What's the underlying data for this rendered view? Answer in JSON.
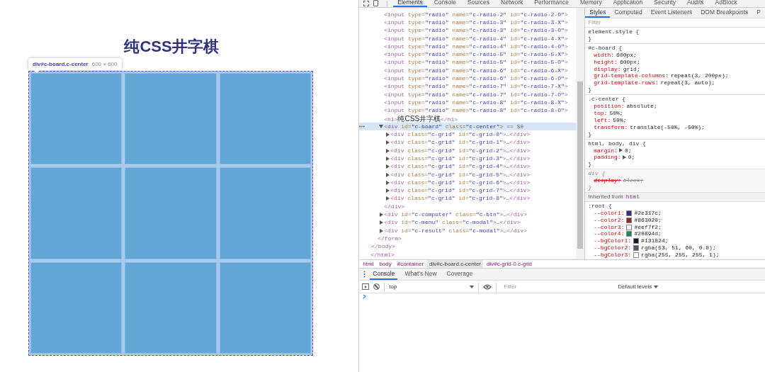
{
  "page": {
    "title": "纯CSS井字棋",
    "tooltip": {
      "selector": "div#c-board.c-center",
      "size": "600 × 600"
    }
  },
  "devtools": {
    "tabs": [
      {
        "label": "Elements",
        "selected": true
      },
      {
        "label": "Console",
        "selected": false
      },
      {
        "label": "Sources",
        "selected": false
      },
      {
        "label": "Network",
        "selected": false
      },
      {
        "label": "Performance",
        "selected": false
      },
      {
        "label": "Memory",
        "selected": false
      },
      {
        "label": "Application",
        "selected": false
      },
      {
        "label": "Security",
        "selected": false
      },
      {
        "label": "Audits",
        "selected": false
      },
      {
        "label": "AdBlock",
        "selected": false
      }
    ],
    "dom": [
      {
        "children": [
          {
            "children": [
              {
                "children": [
                  {
                    "open": "<input type=\"radio\" name=\"c-radio-2\" id=\"c-radio-2-O\">"
                  },
                  {
                    "open": "<input type=\"radio\" name=\"c-radio-3\" id=\"c-radio-3-X\">"
                  },
                  {
                    "open": "<input type=\"radio\" name=\"c-radio-3\" id=\"c-radio-3-O\">"
                  },
                  {
                    "open": "<input type=\"radio\" name=\"c-radio-4\" id=\"c-radio-4-X\">"
                  },
                  {
                    "open": "<input type=\"radio\" name=\"c-radio-4\" id=\"c-radio-4-O\">"
                  },
                  {
                    "open": "<input type=\"radio\" name=\"c-radio-5\" id=\"c-radio-5-X\">"
                  },
                  {
                    "open": "<input type=\"radio\" name=\"c-radio-5\" id=\"c-radio-5-O\">"
                  },
                  {
                    "open": "<input type=\"radio\" name=\"c-radio-6\" id=\"c-radio-6-X\">"
                  },
                  {
                    "open": "<input type=\"radio\" name=\"c-radio-6\" id=\"c-radio-6-O\">"
                  },
                  {
                    "open": "<input type=\"radio\" name=\"c-radio-7\" id=\"c-radio-7-X\">"
                  },
                  {
                    "open": "<input type=\"radio\" name=\"c-radio-7\" id=\"c-radio-7-O\">"
                  },
                  {
                    "open": "<input type=\"radio\" name=\"c-radio-8\" id=\"c-radio-8-X\">"
                  },
                  {
                    "open": "<input type=\"radio\" name=\"c-radio-8\" id=\"c-radio-8-O\">"
                  },
                  {
                    "open": "<h1>纯CSS井字棋</h1>"
                  },
                  {
                    "open": "<div id=\"c-board\" class=\"c-center\">",
                    "suffix": "== $0",
                    "selected": true,
                    "expanded": true,
                    "close": "</div>",
                    "children": [
                      {
                        "open": "<div class=\"c-grid\" id=\"c-grid-0\">…</div>",
                        "expanded": false,
                        "selected": false
                      },
                      {
                        "open": "<div class=\"c-grid\" id=\"c-grid-1\">…</div>",
                        "expanded": false,
                        "selected": false
                      },
                      {
                        "open": "<div class=\"c-grid\" id=\"c-grid-2\">…</div>",
                        "expanded": false,
                        "selected": false
                      },
                      {
                        "open": "<div class=\"c-grid\" id=\"c-grid-3\">…</div>",
                        "expanded": false,
                        "selected": false
                      },
                      {
                        "open": "<div class=\"c-grid\" id=\"c-grid-4\">…</div>",
                        "expanded": false,
                        "selected": false
                      },
                      {
                        "open": "<div class=\"c-grid\" id=\"c-grid-5\">…</div>",
                        "expanded": false,
                        "selected": false
                      },
                      {
                        "open": "<div class=\"c-grid\" id=\"c-grid-6\">…</div>",
                        "expanded": false,
                        "selected": false
                      },
                      {
                        "open": "<div class=\"c-grid\" id=\"c-grid-7\">…</div>",
                        "expanded": false,
                        "selected": false
                      },
                      {
                        "open": "<div class=\"c-grid\" id=\"c-grid-8\">…</div>",
                        "expanded": false,
                        "selected": false
                      }
                    ]
                  },
                  {
                    "open": "<div id=\"c-computer\" class=\"c-btn\">…</div>",
                    "expanded": false,
                    "selected": false
                  },
                  {
                    "open": "<div id=\"c-menu\" class=\"c-modal\">…</div>",
                    "expanded": false,
                    "selected": false
                  },
                  {
                    "open": "<div id=\"c-result\" class=\"c-modal\">…</div>",
                    "expanded": false,
                    "selected": false
                  }
                ],
                "close": "</form>"
              }
            ],
            "close": "</body>"
          }
        ],
        "close": "</html>"
      }
    ],
    "breadcrumbs": [
      {
        "label": "html",
        "selected": false
      },
      {
        "label": "body",
        "selected": false
      },
      {
        "label": "#container",
        "selected": false
      },
      {
        "label": "div#c-board.c-center",
        "selected": true
      },
      {
        "label": "div#c-grid-0.c-grid",
        "selected": false
      }
    ],
    "styles": {
      "tabs": [
        {
          "label": "Styles",
          "selected": true
        },
        {
          "label": "Computed",
          "selected": false
        },
        {
          "label": "Event Listeners",
          "selected": false
        },
        {
          "label": "DOM Breakpoints",
          "selected": false
        },
        {
          "label": "P",
          "selected": false
        }
      ],
      "filter": {
        "placeholder": "Filter"
      },
      "rules": [
        {
          "kind": "author",
          "selector": "element.style {",
          "close": "}"
        },
        {
          "kind": "author",
          "selector": "#c-board {",
          "close": "}",
          "props": [
            {
              "name": "width:",
              "value": "600px;"
            },
            {
              "name": "height:",
              "value": "600px;"
            },
            {
              "name": "display:",
              "value": "grid;"
            },
            {
              "name": "grid-template-columns:",
              "value": "repeat(3, 200px);"
            },
            {
              "name": "grid-template-rows:",
              "value": "repeat(3, auto);"
            }
          ]
        },
        {
          "kind": "author",
          "selector": ".c-center {",
          "close": "}",
          "props": [
            {
              "name": "position:",
              "value": "absolute;"
            },
            {
              "name": "top:",
              "value": "50%;"
            },
            {
              "name": "left:",
              "value": "50%;"
            },
            {
              "name": "transform:",
              "value": "translate(-50%, -50%);"
            }
          ]
        },
        {
          "kind": "author",
          "selector": "html, body, div {",
          "close": "}",
          "props": [
            {
              "name": "margin:",
              "value": "0;",
              "expandable": true
            },
            {
              "name": "padding:",
              "value": "0;",
              "expandable": true
            }
          ]
        },
        {
          "kind": "useragent",
          "selector": "div {",
          "close": "}",
          "props": [
            {
              "name": "display:",
              "value": "block;",
              "struck": true
            }
          ]
        },
        {
          "kind": "inherited",
          "label": "Inherited from",
          "tag": "html"
        },
        {
          "kind": "author",
          "selector": ":root {",
          "props": [
            {
              "name": "--color1:",
              "value": "#2e317c;",
              "color": "#2e317c"
            },
            {
              "name": "--color2:",
              "value": "#863020;",
              "color": "#863020"
            },
            {
              "name": "--color3:",
              "value": "#eef7f2;",
              "color": "#eef7f2"
            },
            {
              "name": "--color4:",
              "value": "#20894d;",
              "color": "#20894d"
            },
            {
              "name": "--bgColor1:",
              "value": "#131824;",
              "color": "#131824"
            },
            {
              "name": "--bgColor2:",
              "value": "rgba(53, 51, 60, 0.8);",
              "color": "#57555e"
            },
            {
              "name": "--bgColor3:",
              "value": "rgba(255, 255, 255, 1);",
              "color": "#ffffff"
            }
          ]
        }
      ]
    },
    "drawer": {
      "tabs": [
        {
          "label": "Console",
          "selected": true
        },
        {
          "label": "What's New",
          "selected": false
        },
        {
          "label": "Coverage",
          "selected": false
        }
      ],
      "context": "top",
      "filter": {
        "placeholder": "Filter"
      },
      "levels": "Default levels"
    }
  }
}
